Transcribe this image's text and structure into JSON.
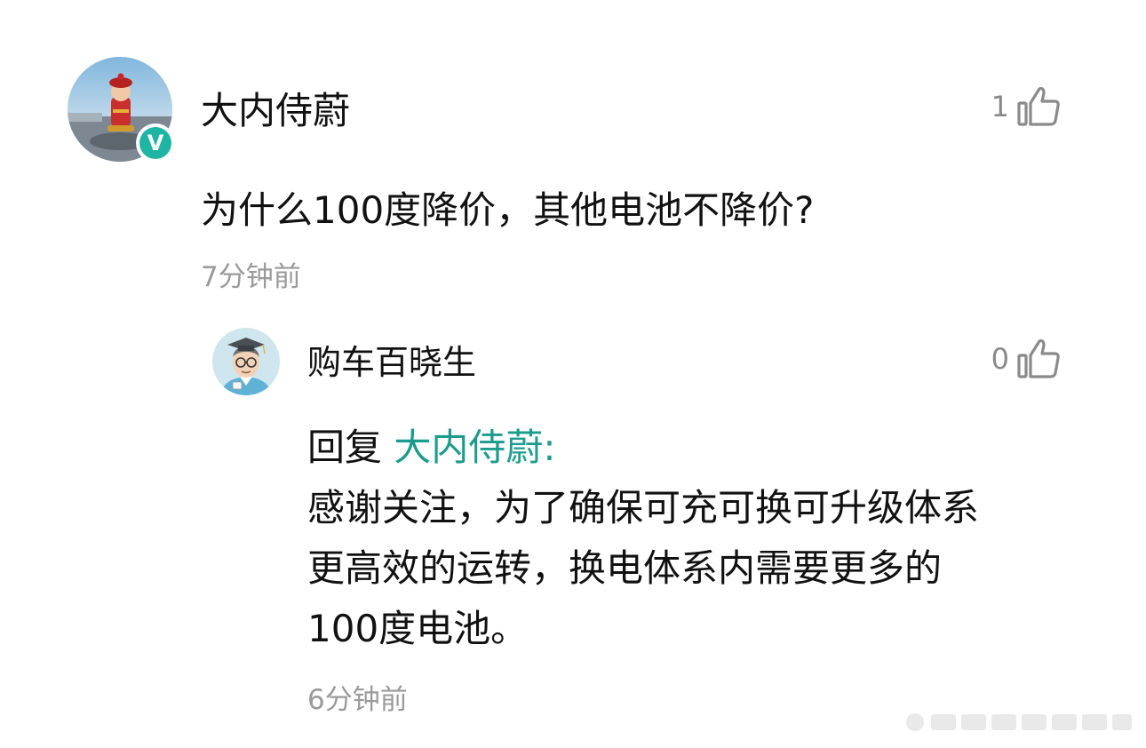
{
  "comment": {
    "author": "大内侍蔚",
    "likes": "1",
    "text": "为什么100度降价，其他电池不降价?",
    "time": "7分钟前",
    "verified_badge": "V",
    "avatar_icon": "avatar-photo-figurine"
  },
  "reply": {
    "author": "购车百晓生",
    "likes": "0",
    "reply_prefix": "回复 ",
    "mention": "大内侍蔚:",
    "lines": [
      "感谢关注，为了确保可充可换可升级体系",
      "更高效的运转，换电体系内需要更多的",
      "100度电池。"
    ],
    "time": "6分钟前",
    "avatar_icon": "avatar-cartoon-graduate"
  },
  "colors": {
    "text": "#111111",
    "muted": "#9a9a9a",
    "mention": "#1b9c8c",
    "verified": "#1fb5a5"
  }
}
